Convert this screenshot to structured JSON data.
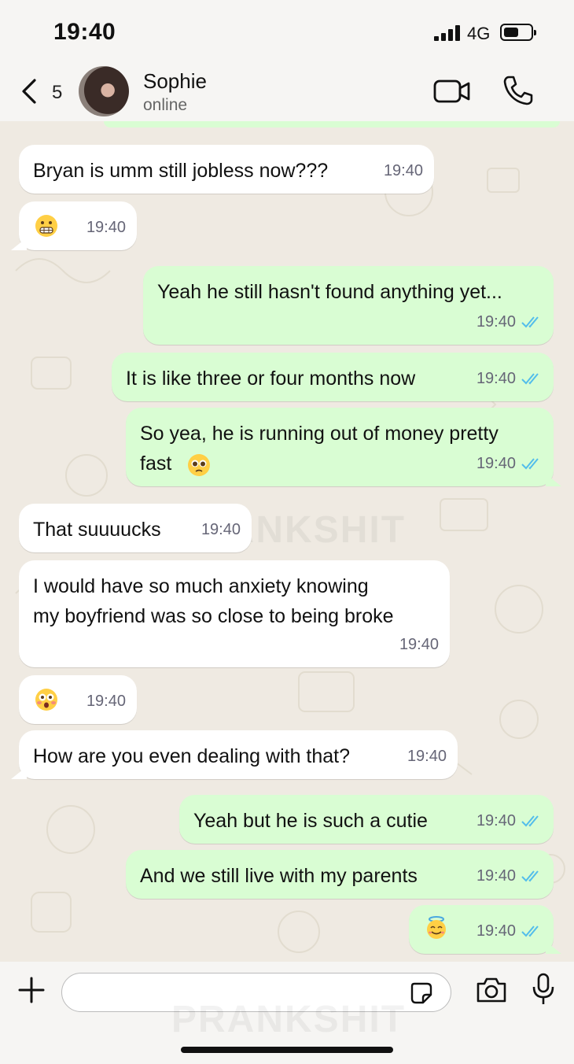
{
  "status_bar": {
    "time": "19:40",
    "network": "4G",
    "battery_level_fraction": 0.55
  },
  "header": {
    "back_icon": "chevron-left-icon",
    "unread_count": "5",
    "contact_name": "Sophie",
    "presence": "online",
    "video_icon": "video-camera-icon",
    "call_icon": "phone-icon"
  },
  "watermark": "PRANKSHIT",
  "colors": {
    "incoming_bubble": "#ffffff",
    "outgoing_bubble": "#d9fdd3",
    "read_ticks": "#53bdeb",
    "chat_background": "#efeae2"
  },
  "messages": [
    {
      "direction": "incoming",
      "text": "Bryan is umm still jobless now???",
      "time": "19:40"
    },
    {
      "direction": "incoming",
      "emoji": "grimacing-face",
      "time": "19:40"
    },
    {
      "direction": "outgoing",
      "text": "Yeah he still hasn't found anything yet...",
      "time": "19:40",
      "status": "read"
    },
    {
      "direction": "outgoing",
      "text": "It is like three or four months now",
      "time": "19:40",
      "status": "read"
    },
    {
      "direction": "outgoing",
      "text": "So yea, he is running out of money pretty\nfast",
      "emoji": "pleading-face",
      "time": "19:40",
      "status": "read"
    },
    {
      "direction": "incoming",
      "text": "That suuuucks",
      "time": "19:40"
    },
    {
      "direction": "incoming",
      "text": "I would have so much anxiety knowing\nmy boyfriend was so close to being broke",
      "time": "19:40"
    },
    {
      "direction": "incoming",
      "emoji": "flushed-face",
      "time": "19:40"
    },
    {
      "direction": "incoming",
      "text": "How are you even dealing with that?",
      "time": "19:40"
    },
    {
      "direction": "outgoing",
      "text": "Yeah but he is such a cutie",
      "time": "19:40",
      "status": "read"
    },
    {
      "direction": "outgoing",
      "text": "And we still live with my parents",
      "time": "19:40",
      "status": "read"
    },
    {
      "direction": "outgoing",
      "emoji": "smiling-face-with-halo",
      "time": "19:40",
      "status": "read"
    }
  ],
  "input_bar": {
    "plus_icon": "plus-icon",
    "input_value": "",
    "sticker_icon": "sticker-icon",
    "camera_icon": "camera-icon",
    "mic_icon": "microphone-icon"
  }
}
